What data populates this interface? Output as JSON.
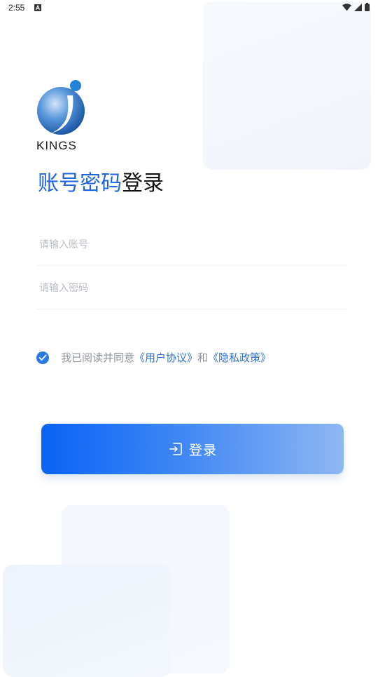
{
  "status_bar": {
    "time": "2:55",
    "notification_icon": "a-icon",
    "right_icons": [
      "wifi-icon",
      "signal-icon",
      "battery-icon"
    ]
  },
  "logo": {
    "text": "KINGS"
  },
  "title": {
    "accent": "账号密码",
    "rest": "登录"
  },
  "form": {
    "account_placeholder": "请输入账号",
    "account_value": "",
    "password_placeholder": "请输入密码",
    "password_value": ""
  },
  "agreement": {
    "checked": true,
    "prefix": "我已阅读并同意",
    "user_agreement": "《用户协议》",
    "conjunction": "和",
    "privacy_policy": "《隐私政策》"
  },
  "login_button": {
    "label": "登录",
    "icon": "login-icon"
  },
  "colors": {
    "accent": "#1f66dd",
    "link": "#2f6fcf",
    "checkbox": "#2a78e4",
    "button_start": "#0a63f5",
    "button_end": "#8fb7f3"
  }
}
